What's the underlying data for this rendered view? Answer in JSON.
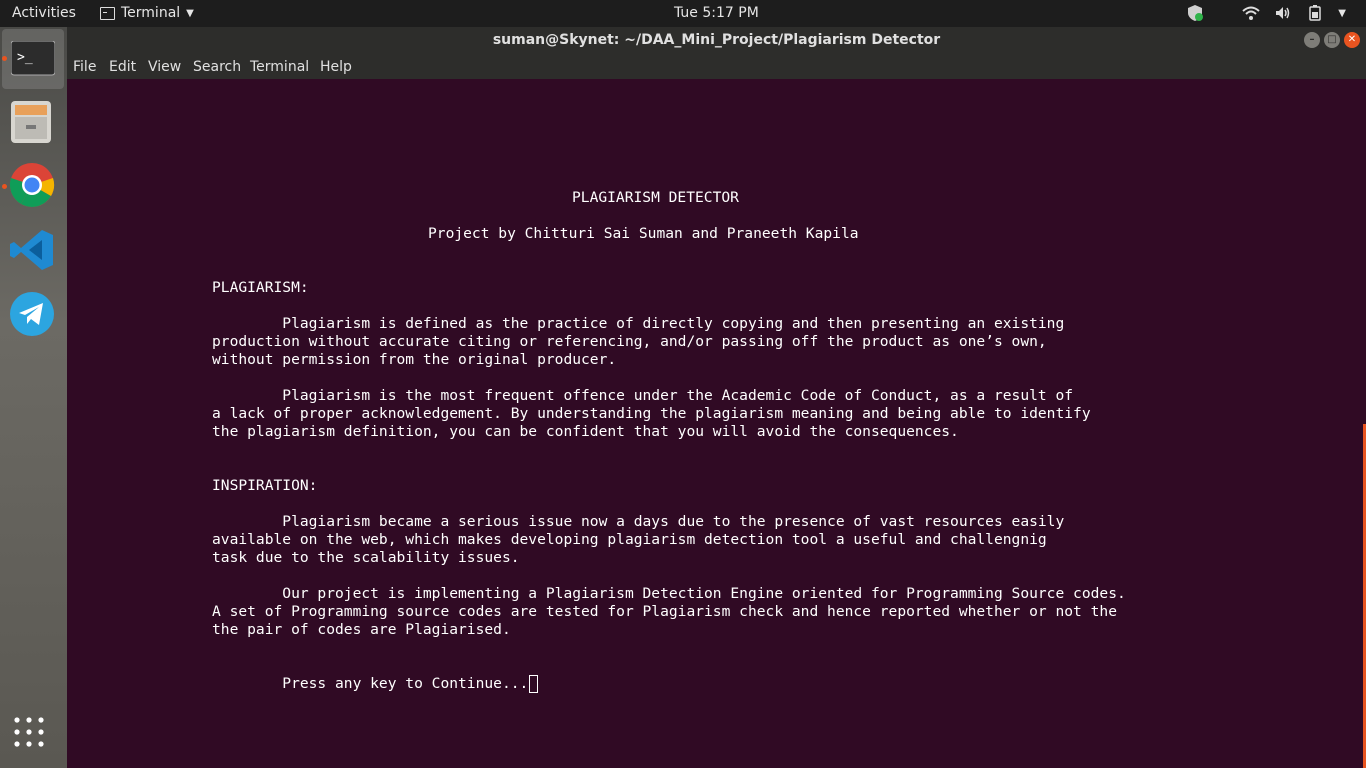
{
  "topbar": {
    "activities": "Activities",
    "app_menu": "Terminal",
    "clock": "Tue  5:17 PM"
  },
  "window": {
    "title": "suman@Skynet: ~/DAA_Mini_Project/Plagiarism Detector",
    "menu": [
      "File",
      "Edit",
      "View",
      "Search",
      "Terminal",
      "Help"
    ]
  },
  "dock": {
    "items": [
      "Terminal",
      "Files",
      "Google Chrome",
      "Visual Studio Code",
      "Telegram",
      "Show Applications"
    ]
  },
  "terminal": {
    "heading": "PLAGIARISM DETECTOR",
    "byline": "Project by Chitturi Sai Suman and Praneeth Kapila",
    "section1_title": "PLAGIARISM:",
    "p1": [
      "        Plagiarism is defined as the practice of directly copying and then presenting an existing",
      "production without accurate citing or referencing, and/or passing off the product as one’s own,",
      "without permission from the original producer."
    ],
    "p2": [
      "        Plagiarism is the most frequent offence under the Academic Code of Conduct, as a result of",
      "a lack of proper acknowledgement. By understanding the plagiarism meaning and being able to identify",
      "the plagiarism definition, you can be confident that you will avoid the consequences."
    ],
    "section2_title": "INSPIRATION:",
    "p3": [
      "        Plagiarism became a serious issue now a days due to the presence of vast resources easily",
      "available on the web, which makes developing plagiarism detection tool a useful and challengnig",
      "task due to the scalability issues."
    ],
    "p4": [
      "        Our project is implementing a Plagiarism Detection Engine oriented for Programming Source codes.",
      "A set of Programming source codes are tested for Plagiarism check and hence reported whether or not the",
      "the pair of codes are Plagiarised."
    ],
    "prompt": "        Press any key to Continue..."
  }
}
